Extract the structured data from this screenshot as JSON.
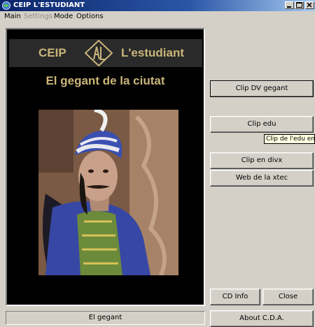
{
  "window": {
    "title": "CEIP L'ESTUDIANT",
    "icon": "app-globe-icon",
    "controls": [
      "minimize-icon",
      "maximize-icon",
      "close-icon"
    ]
  },
  "menu": {
    "main": "Main",
    "settings": "Settings",
    "mode": "Mode",
    "options": "Options"
  },
  "video": {
    "banner_left": "CEIP",
    "banner_right": "L'estudiant",
    "subtitle": "El gegant de la ciutat"
  },
  "status": {
    "text": "El gegant"
  },
  "buttons": {
    "clip_dv": "Clip DV gegant",
    "clip_edu": "Clip edu",
    "clip_divx": "Clip en divx",
    "web_xtec": "Web de la xtec",
    "cd_info": "CD Info",
    "close": "Close",
    "about": "About C.D.A."
  },
  "tooltip": {
    "text": "Clip de l'edu en M"
  },
  "colors": {
    "face": "#d4d0c8",
    "title_start": "#0a246a",
    "title_end": "#a6caf0",
    "gold_text": "#c9b57a",
    "tooltip_bg": "#ffffe1"
  }
}
